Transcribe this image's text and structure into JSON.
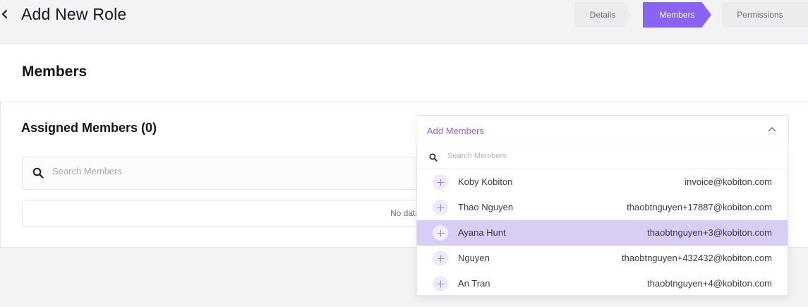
{
  "header": {
    "title": "Add New Role",
    "steps": [
      {
        "label": "Details"
      },
      {
        "label": "Members"
      },
      {
        "label": "Permissions"
      }
    ],
    "accent_color": "#8a63f2"
  },
  "members_section": {
    "title": "Members",
    "assigned_title": "Assigned Members (0)",
    "search_placeholder": "Search Members",
    "empty_text": "No data"
  },
  "add_members_dropdown": {
    "label": "Add Members",
    "search_placeholder": "Search Members",
    "options": [
      {
        "name": "Koby Kobiton",
        "email": "invoice@kobiton.com"
      },
      {
        "name": "Thao Nguyen",
        "email": "thaobtnguyen+17887@kobiton.com"
      },
      {
        "name": "Ayana Hunt",
        "email": "thaobtnguyen+3@kobiton.com",
        "highlighted": true
      },
      {
        "name": "Nguyen",
        "email": "thaobtnguyen+432432@kobiton.com"
      },
      {
        "name": "An Tran",
        "email": "thaobtnguyen+4@kobiton.com"
      }
    ]
  }
}
